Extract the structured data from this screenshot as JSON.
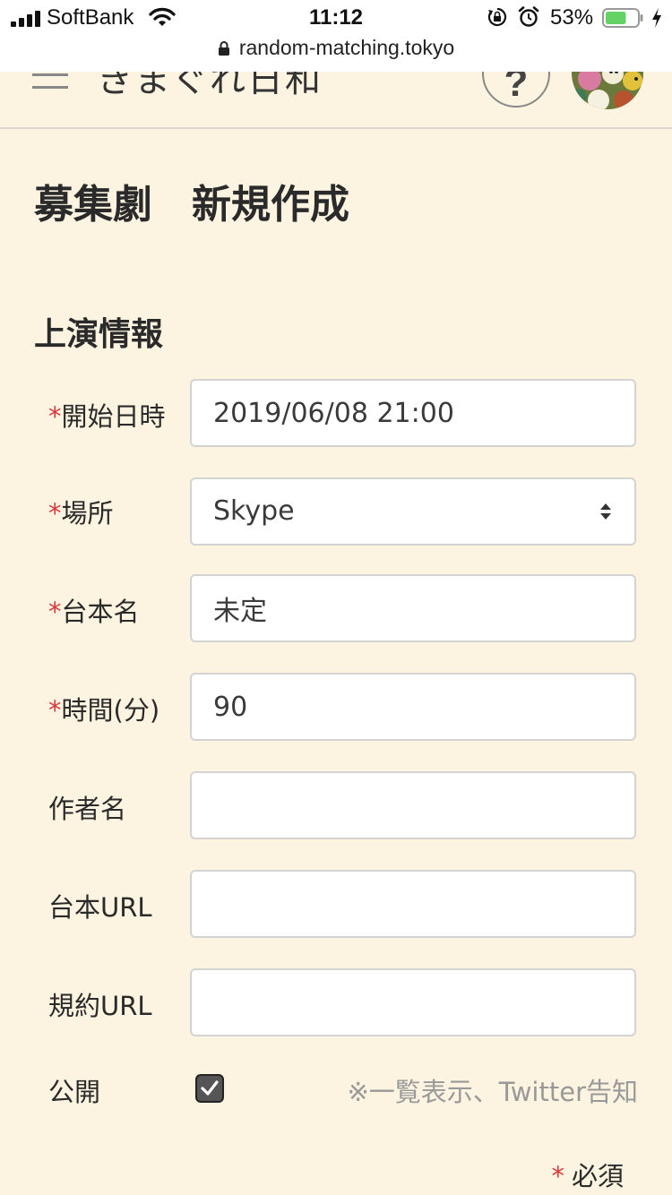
{
  "status_bar": {
    "carrier": "SoftBank",
    "time": "11:12",
    "battery": "53%",
    "battery_level": 0.53,
    "url": "random-matching.tokyo"
  },
  "header": {
    "brand": "きまぐれ日和",
    "help_label": "?"
  },
  "page": {
    "title": "募集劇　新規作成",
    "section_title": "上演情報"
  },
  "form": {
    "required_mark": "*",
    "start_label": "開始日時",
    "start_value": "2019/06/08 21:00",
    "place_label": "場所",
    "place_value": "Skype",
    "script_name_label": "台本名",
    "script_name_value": "未定",
    "duration_label": "時間(分)",
    "duration_value": "90",
    "author_label": "作者名",
    "author_value": "",
    "script_url_label": "台本URL",
    "script_url_value": "",
    "terms_url_label": "規約URL",
    "terms_url_value": "",
    "public_label": "公開",
    "public_checked": true,
    "public_note": "※一覧表示、Twitter告知",
    "required_legend": "必須"
  },
  "colors": {
    "background": "#fdf3e1",
    "required": "#d9393b",
    "field_border": "#d3d3d3",
    "battery_fill": "#64d264"
  },
  "icons": {
    "menu": "hamburger-icon",
    "help": "help-icon",
    "secure": "lock-icon",
    "select": "select-caret-icon",
    "checkbox": "checkmark-icon"
  }
}
